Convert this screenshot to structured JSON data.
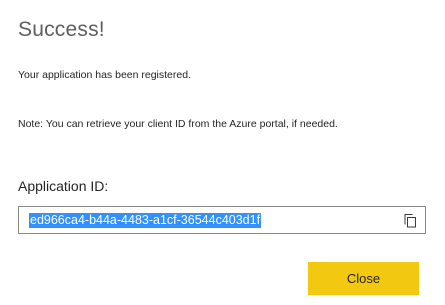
{
  "dialog": {
    "title": "Success!",
    "message": "Your application has been registered.",
    "note": "Note: You can retrieve your client ID from the Azure portal, if needed.",
    "field": {
      "label": "Application ID:",
      "value": "ed966ca4-b44a-4483-a1cf-36544c403d1f",
      "value_selected": true,
      "copy_icon": "copy-icon"
    },
    "close_label": "Close"
  },
  "colors": {
    "accent_button": "#f2c811",
    "selection": "#3390ff",
    "title_text": "#605e5c",
    "body_text": "#252423",
    "field_border": "#8a8886"
  }
}
